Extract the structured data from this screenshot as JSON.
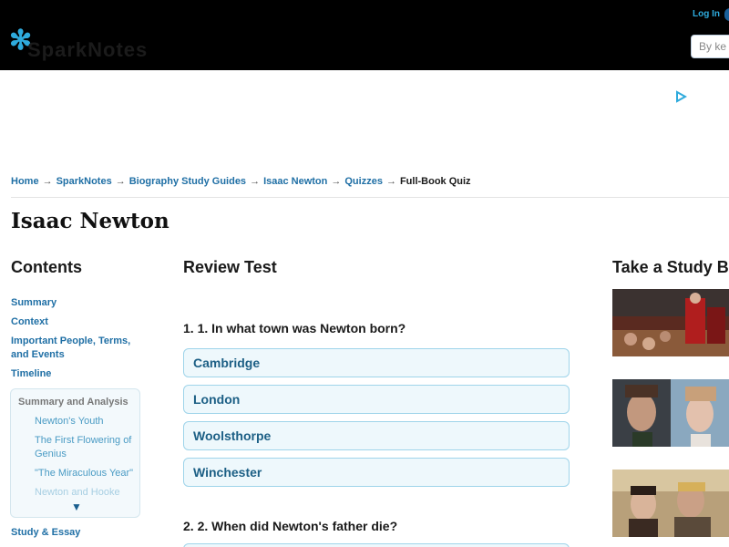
{
  "header": {
    "logo_text": "SparkNotes",
    "login_label": "Log In",
    "search_placeholder": "By ke"
  },
  "breadcrumb": [
    {
      "label": "Home"
    },
    {
      "label": "SparkNotes"
    },
    {
      "label": "Biography Study Guides"
    },
    {
      "label": "Isaac Newton"
    },
    {
      "label": "Quizzes"
    },
    {
      "label": "Full-Book Quiz"
    }
  ],
  "page_title": "Isaac Newton",
  "sidebar": {
    "heading": "Contents",
    "links": [
      "Summary",
      "Context",
      "Important People, Terms, and Events",
      "Timeline"
    ],
    "summary_analysis": {
      "title": "Summary and Analysis",
      "items": [
        "Newton's Youth",
        "The First Flowering of Genius",
        "\"The Miraculous Year\"",
        "Newton and Hooke"
      ]
    },
    "bottom_link": "Study & Essay"
  },
  "main": {
    "heading": "Review Test",
    "questions": [
      {
        "text": "1. 1. In what town was Newton born?",
        "answers": [
          "Cambridge",
          "London",
          "Woolsthorpe",
          "Winchester"
        ]
      },
      {
        "text": "2. 2. When did Newton's father die?",
        "answers": []
      }
    ]
  },
  "right": {
    "heading": "Take a Study Break"
  },
  "colors": {
    "link": "#1f6fa5",
    "accent": "#2eaadc",
    "answer_bg": "#eef8fc",
    "answer_border": "#9fd4ea"
  }
}
